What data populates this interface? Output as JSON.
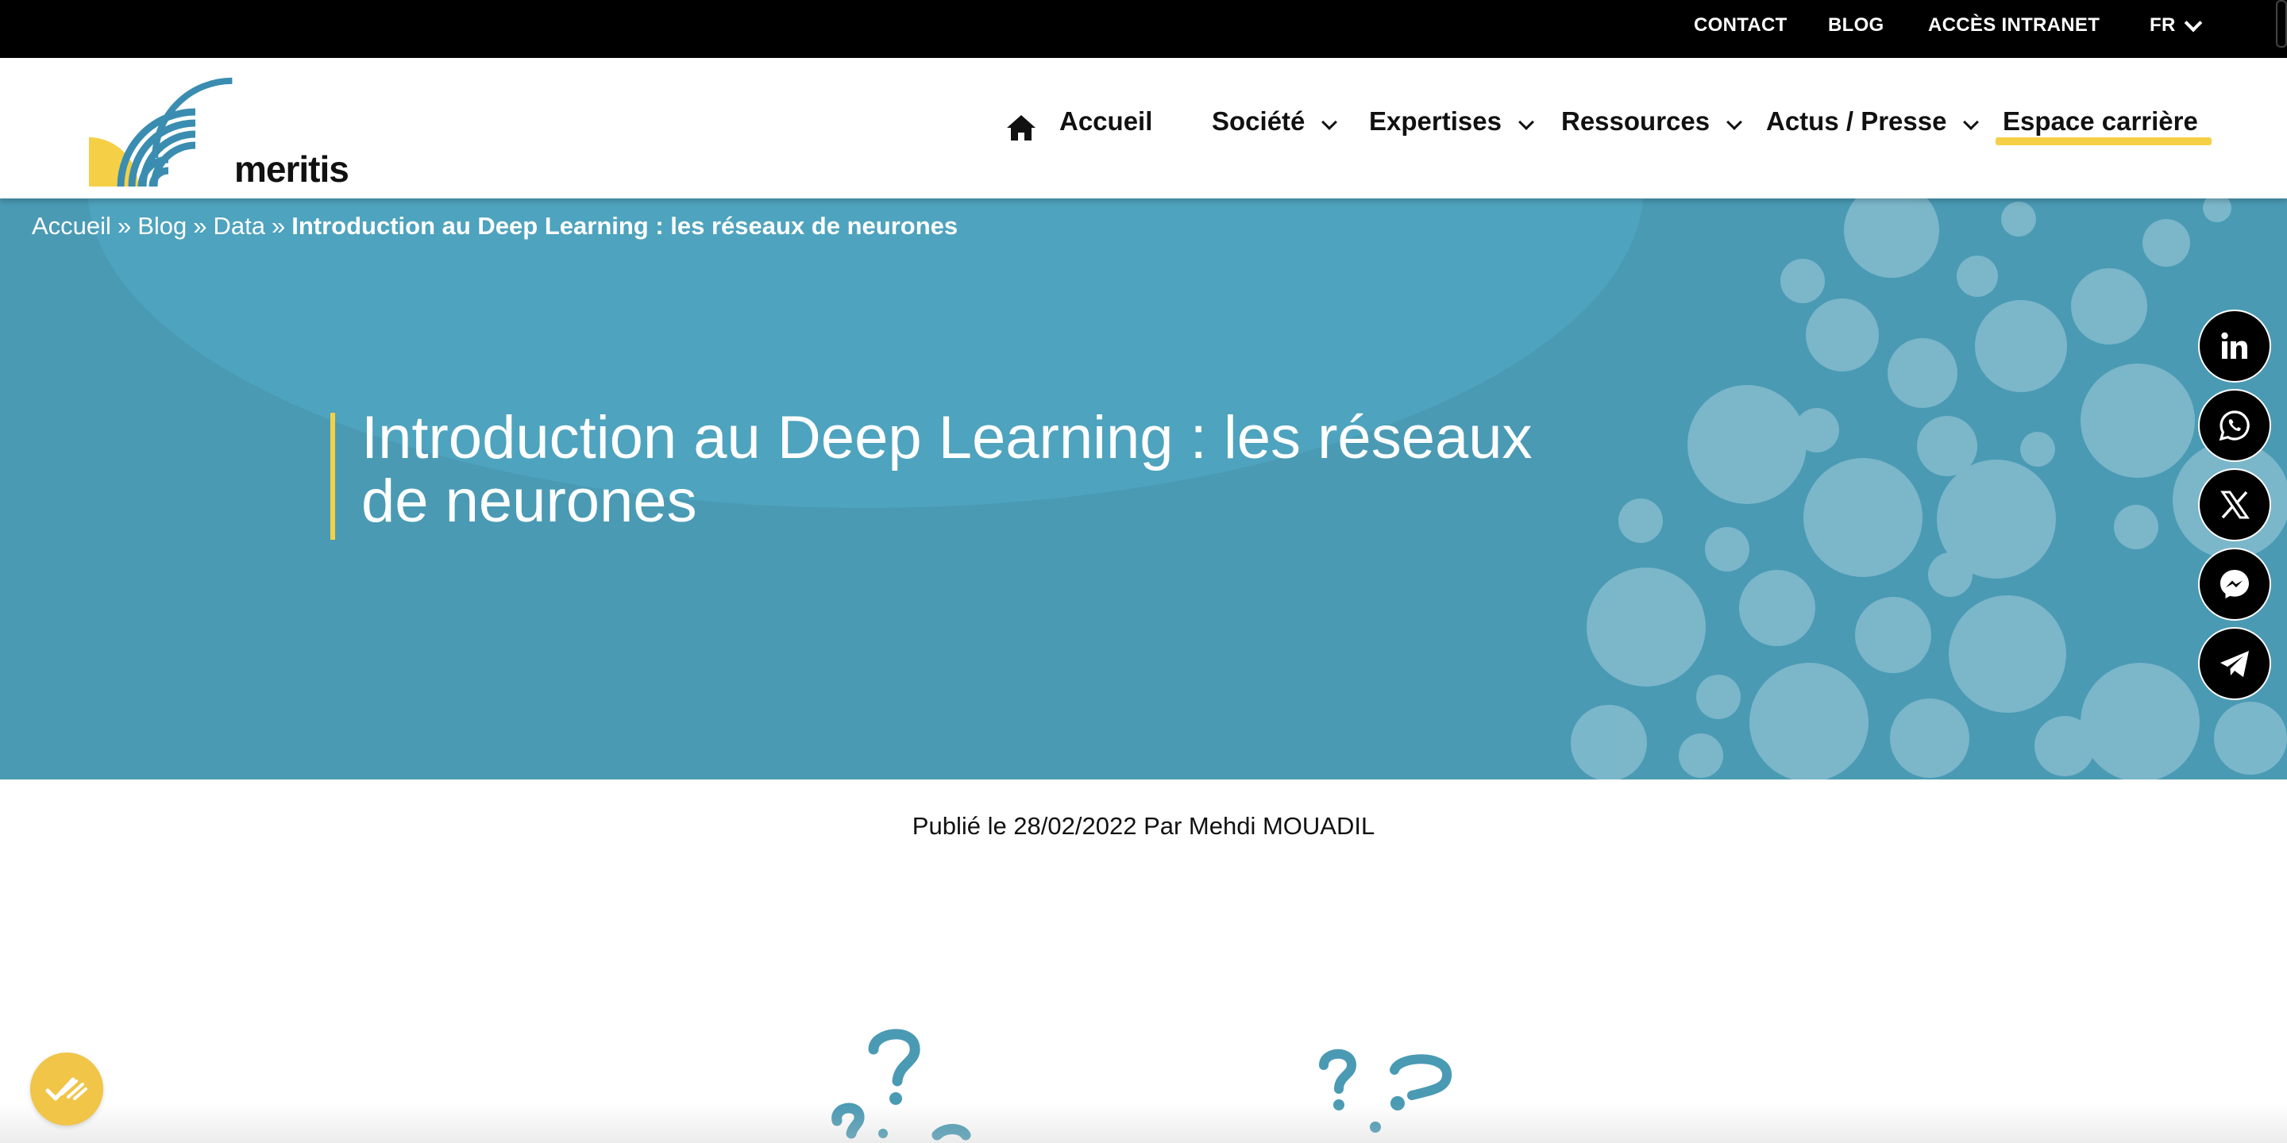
{
  "topbar": {
    "links": [
      "CONTACT",
      "BLOG",
      "ACCÈS INTRANET"
    ],
    "language": "FR"
  },
  "header": {
    "logo_text": "meritis",
    "nav": {
      "home": "Accueil",
      "societe": "Société",
      "expertises": "Expertises",
      "ressources": "Ressources",
      "actus": "Actus / Presse",
      "career": "Espace carrière"
    }
  },
  "breadcrumb": {
    "items": [
      "Accueil",
      "Blog",
      "Data"
    ],
    "separator": "»",
    "current": "Introduction au Deep Learning : les réseaux de neurones"
  },
  "hero": {
    "title": "Introduction au Deep Learning : les réseaux de neurones"
  },
  "share": {
    "icons": [
      "linkedin-icon",
      "whatsapp-icon",
      "x-icon",
      "messenger-icon",
      "telegram-icon"
    ]
  },
  "article": {
    "published": "Publié le 28/02/2022 Par Mehdi MOUADIL"
  },
  "colors": {
    "topbar": "#000000",
    "hero": "#4a9ab4",
    "accent": "#f5d046",
    "bubble": "#8cc0d1",
    "question_marks": "#4a9ab4",
    "cookie": "#f0c548"
  }
}
